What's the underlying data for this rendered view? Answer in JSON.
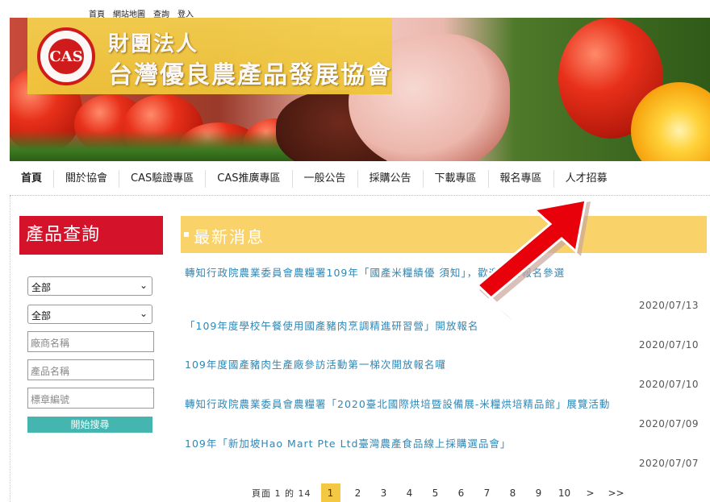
{
  "top_links": [
    "首頁",
    "網站地圖",
    "查詢",
    "登入"
  ],
  "org": {
    "line1": "財團法人",
    "line2": "台灣優良農產品發展協會",
    "logo_text": "CAS"
  },
  "nav": [
    "首頁",
    "關於協會",
    "CAS驗證專區",
    "CAS推廣專區",
    "一般公告",
    "採購公告",
    "下載專區",
    "報名專區",
    "人才招募"
  ],
  "sidebar": {
    "title": "產品查詢",
    "select1": "全部",
    "select2": "全部",
    "vendor_placeholder": "廠商名稱",
    "product_placeholder": "產品名稱",
    "label_placeholder": "標章編號",
    "search_button": "開始搜尋"
  },
  "news": {
    "title": "最新消息",
    "items": [
      {
        "text": "轉知行政院農業委員會農糧署109年「國產米糧績優 須知」，歡迎踴躍報名參選",
        "date": "2020/07/13"
      },
      {
        "text": "「109年度學校午餐使用國產豬肉烹調精進研習營」開放報名",
        "date": "2020/07/10"
      },
      {
        "text": "109年度國產豬肉生產廠參訪活動第一梯次開放報名囉",
        "date": "2020/07/10"
      },
      {
        "text": "轉知行政院農業委員會農糧署「2020臺北國際烘培暨設備展-米糧烘培精品館」展覽活動",
        "date": "2020/07/09"
      },
      {
        "text": "109年「新加坡Hao Mart Pte Ltd臺灣農產食品線上採購選品會」",
        "date": "2020/07/07"
      }
    ]
  },
  "pager": {
    "info": "頁面 1 的 14",
    "pages": [
      "1",
      "2",
      "3",
      "4",
      "5",
      "6",
      "7",
      "8",
      "9",
      "10",
      ">",
      ">>"
    ]
  },
  "colors": {
    "accent_red": "#d4132a",
    "news_yellow": "#f9d36a",
    "link_blue": "#2f87b5",
    "button_teal": "#45b5b0",
    "arrow_red": "#e8000a"
  }
}
